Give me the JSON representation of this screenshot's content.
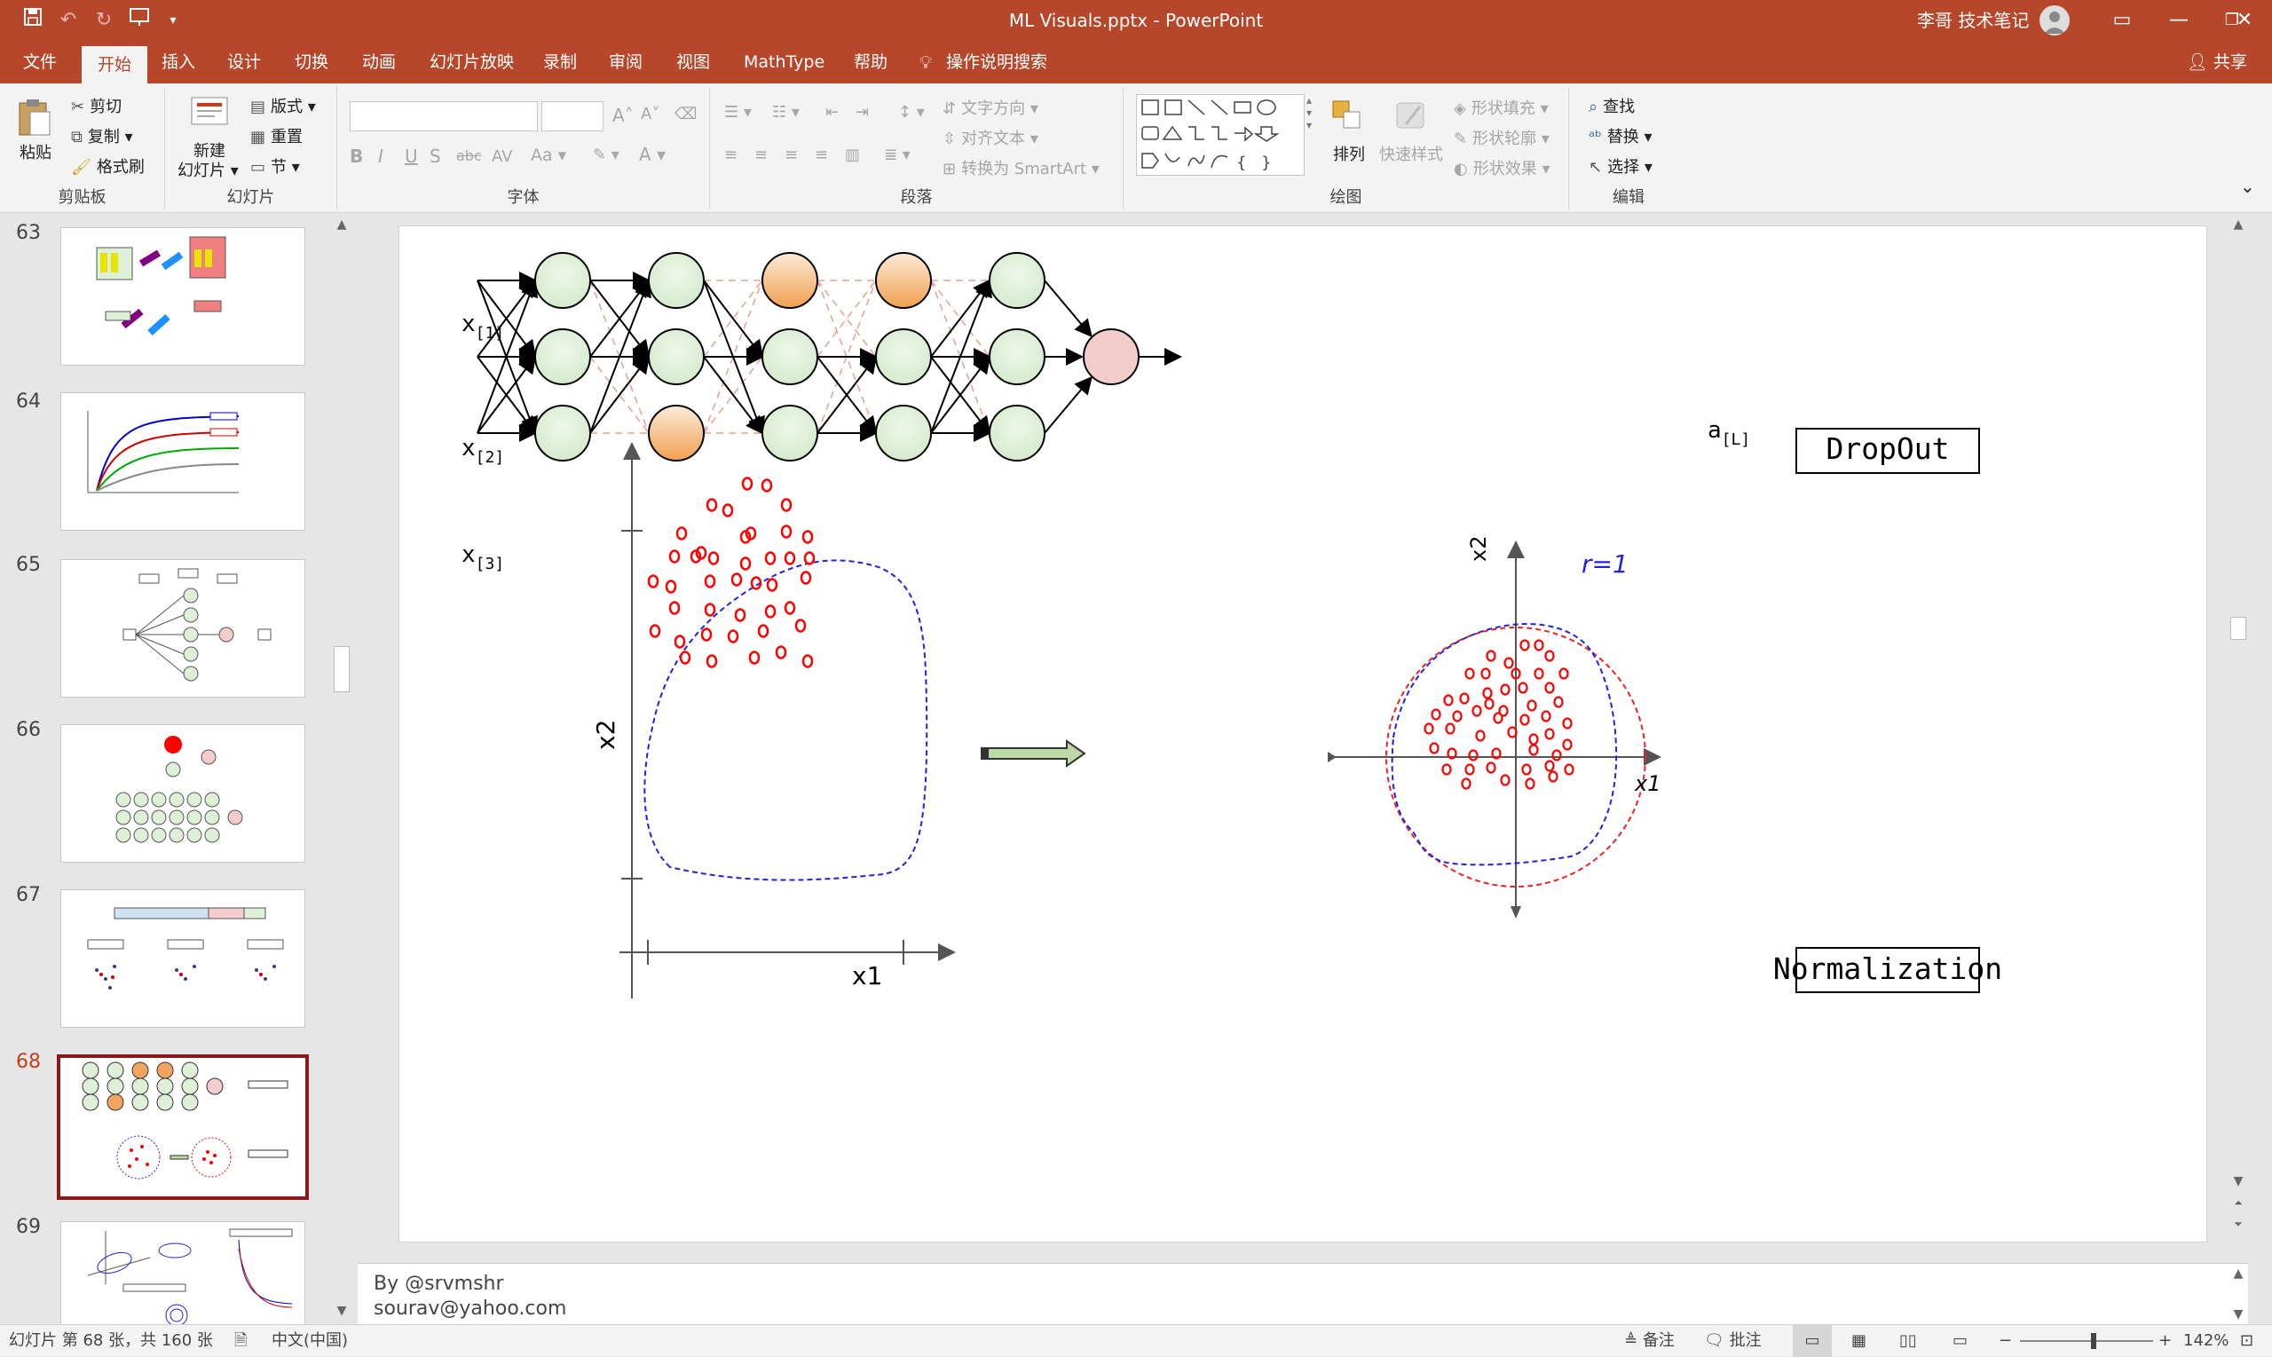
{
  "app": {
    "title": "ML Visuals.pptx  -  PowerPoint",
    "user": "李哥 技术笔记",
    "colors": {
      "accent": "#b7472a",
      "active_thumb_border": "#8b1a1a"
    }
  },
  "quick_access": {
    "icons": [
      "save-icon",
      "undo-icon",
      "redo-icon",
      "present-icon",
      "customize-icon"
    ]
  },
  "tabs": [
    {
      "label": "文件"
    },
    {
      "label": "开始"
    },
    {
      "label": "插入"
    },
    {
      "label": "设计"
    },
    {
      "label": "切换"
    },
    {
      "label": "动画"
    },
    {
      "label": "幻灯片放映"
    },
    {
      "label": "录制"
    },
    {
      "label": "审阅"
    },
    {
      "label": "视图"
    },
    {
      "label": "MathType"
    },
    {
      "label": "帮助"
    },
    {
      "label": "操作说明搜索"
    }
  ],
  "share_label": "共享",
  "ribbon": {
    "clipboard": {
      "paste": "粘贴",
      "cut": "剪切",
      "copy": "复制",
      "format_painter": "格式刷",
      "group": "剪贴板"
    },
    "slides": {
      "new_slide_1": "新建",
      "new_slide_2": "幻灯片",
      "layout": "版式",
      "reset": "重置",
      "section": "节",
      "group": "幻灯片"
    },
    "font": {
      "group": "字体"
    },
    "paragraph": {
      "text_direction": "文字方向",
      "align_text": "对齐文本",
      "smartart": "转换为 SmartArt",
      "group": "段落"
    },
    "drawing": {
      "arrange": "排列",
      "quick_styles": "快速样式",
      "shape_fill": "形状填充",
      "shape_outline": "形状轮廓",
      "shape_effects": "形状效果",
      "group": "绘图"
    },
    "editing": {
      "find": "查找",
      "replace": "替换",
      "select": "选择",
      "group": "编辑"
    }
  },
  "thumbnails": [
    {
      "num": "63"
    },
    {
      "num": "64"
    },
    {
      "num": "65"
    },
    {
      "num": "66"
    },
    {
      "num": "67"
    },
    {
      "num": "68"
    },
    {
      "num": "69"
    }
  ],
  "slide": {
    "inputs": [
      "x",
      "x",
      "x"
    ],
    "input_subs": [
      "[1]",
      "[2]",
      "[3]"
    ],
    "output": "a",
    "output_sub": "[L]",
    "dropout_label": "DropOut",
    "normalization_label": "Normalization",
    "plot_left": {
      "xlabel": "x1",
      "ylabel": "x2"
    },
    "plot_right": {
      "xlabel": "x1",
      "ylabel": "x2",
      "radius_label": "r=1"
    },
    "colors": {
      "green_node": "#dff0d8",
      "orange_node": "#f4a460",
      "red_node": "#f4cccc",
      "points": "#ff0000",
      "hull": "#2222dd"
    }
  },
  "notes": {
    "line1": "By @srvmshr",
    "line2": "sourav@yahoo.com"
  },
  "status": {
    "slide_info": "幻灯片 第 68 张，共 160 张",
    "language": "中文(中国)",
    "notes": "备注",
    "comments": "批注",
    "zoom": "142%"
  }
}
